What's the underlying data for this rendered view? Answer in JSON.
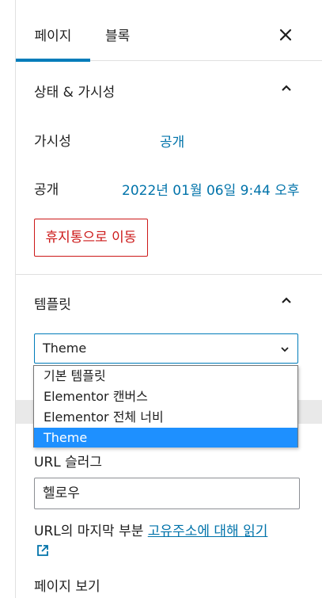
{
  "tabs": {
    "page": "페이지",
    "block": "블록"
  },
  "status_panel": {
    "title": "상태 & 가시성",
    "visibility_label": "가시성",
    "visibility_value": "공개",
    "publish_label": "공개",
    "publish_value": "2022년 01월 06일 9:44 오후",
    "trash_button": "휴지통으로 이동"
  },
  "template_panel": {
    "title": "템플릿",
    "selected": "Theme",
    "options": [
      "기본 템플릿",
      "Elementor 캔버스",
      "Elementor 전체 너비",
      "Theme"
    ]
  },
  "slug": {
    "label": "URL 슬러그",
    "value": "헬로우",
    "help_prefix": "URL의 마지막 부분",
    "help_link": "고유주소에 대해 읽기"
  },
  "view_page": "페이지 보기",
  "colors": {
    "accent": "#007cba",
    "link": "#0073aa",
    "danger": "#cc1818",
    "option_selected": "#1e90ff"
  }
}
